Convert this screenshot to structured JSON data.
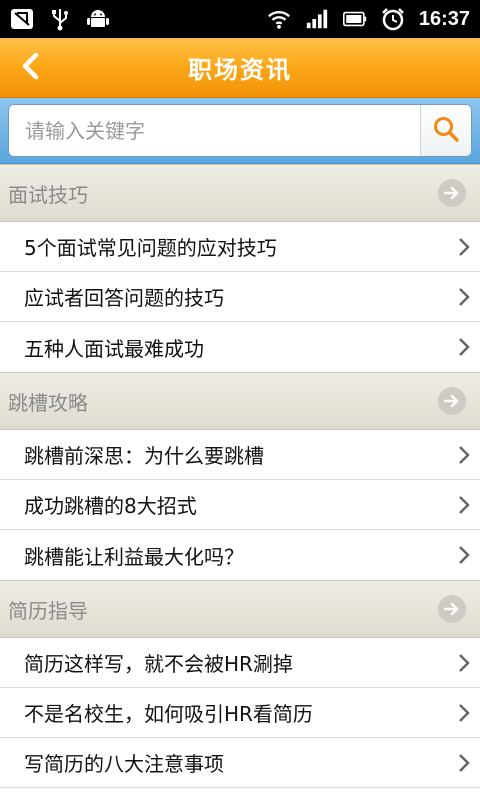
{
  "status_bar": {
    "time": "16:37"
  },
  "header": {
    "title": "职场资讯"
  },
  "search": {
    "placeholder": "请输入关键字"
  },
  "sections": [
    {
      "title": "面试技巧",
      "items": [
        "5个面试常见问题的应对技巧",
        "应试者回答问题的技巧",
        "五种人面试最难成功"
      ]
    },
    {
      "title": "跳槽攻略",
      "items": [
        "跳槽前深思：为什么要跳槽",
        "成功跳槽的8大招式",
        "跳槽能让利益最大化吗？"
      ]
    },
    {
      "title": "简历指导",
      "items": [
        "简历这样写，就不会被HR涮掉",
        "不是名校生，如何吸引HR看简历",
        "写简历的八大注意事项"
      ]
    }
  ],
  "icons": {
    "back": "chevron-left-icon",
    "search": "magnifier-icon",
    "more": "circle-arrow-right-icon",
    "item": "chevron-right-icon"
  },
  "colors": {
    "title_bar": "#fca91a",
    "search_bar": "#5aa6dd",
    "search_icon": "#f08a14"
  }
}
